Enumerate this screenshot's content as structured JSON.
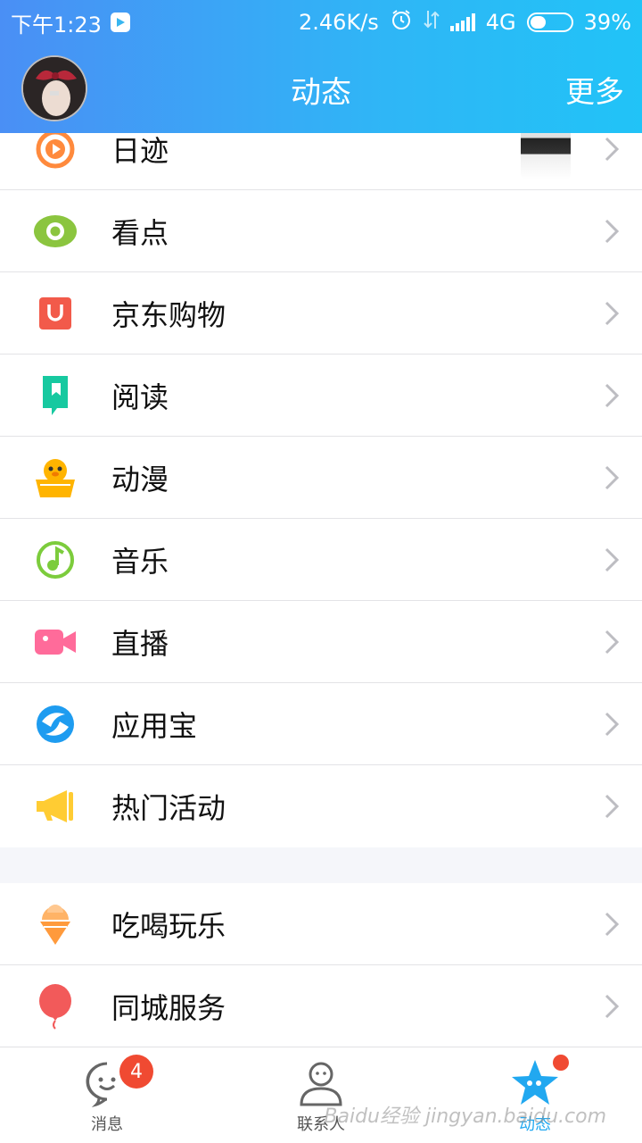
{
  "status_bar": {
    "time": "下午1:23",
    "network_speed": "2.46K/s",
    "network_type": "4G",
    "battery": "39%",
    "battery_level": 0.39
  },
  "header": {
    "title": "动态",
    "more_label": "更多"
  },
  "menu_group_1": [
    {
      "label": "日迹",
      "icon": "play-circle-icon",
      "color": "#ff8a3d"
    },
    {
      "label": "看点",
      "icon": "eye-icon",
      "color": "#8bc53f"
    },
    {
      "label": "京东购物",
      "icon": "shopping-bag-icon",
      "color": "#f25a4a"
    },
    {
      "label": "阅读",
      "icon": "bookmark-book-icon",
      "color": "#17c9a0"
    },
    {
      "label": "动漫",
      "icon": "penguin-icon",
      "color": "#ffb400"
    },
    {
      "label": "音乐",
      "icon": "music-note-icon",
      "color": "#7ccc3c"
    },
    {
      "label": "直播",
      "icon": "video-camera-icon",
      "color": "#ff6b9a"
    },
    {
      "label": "应用宝",
      "icon": "app-store-icon",
      "color": "#1e9cf0"
    },
    {
      "label": "热门活动",
      "icon": "megaphone-icon",
      "color": "#ffcc33"
    }
  ],
  "menu_group_2": [
    {
      "label": "吃喝玩乐",
      "icon": "ice-cream-icon",
      "color": "#ff9a3c"
    },
    {
      "label": "同城服务",
      "icon": "balloon-icon",
      "color": "#f25a5a"
    }
  ],
  "tab_bar": {
    "tabs": [
      {
        "label": "消息",
        "badge": "4"
      },
      {
        "label": "联系人"
      },
      {
        "label": "动态"
      }
    ],
    "accent": "#21a8f0"
  },
  "watermark": "Baidu经验 jingyan.baidu.com"
}
